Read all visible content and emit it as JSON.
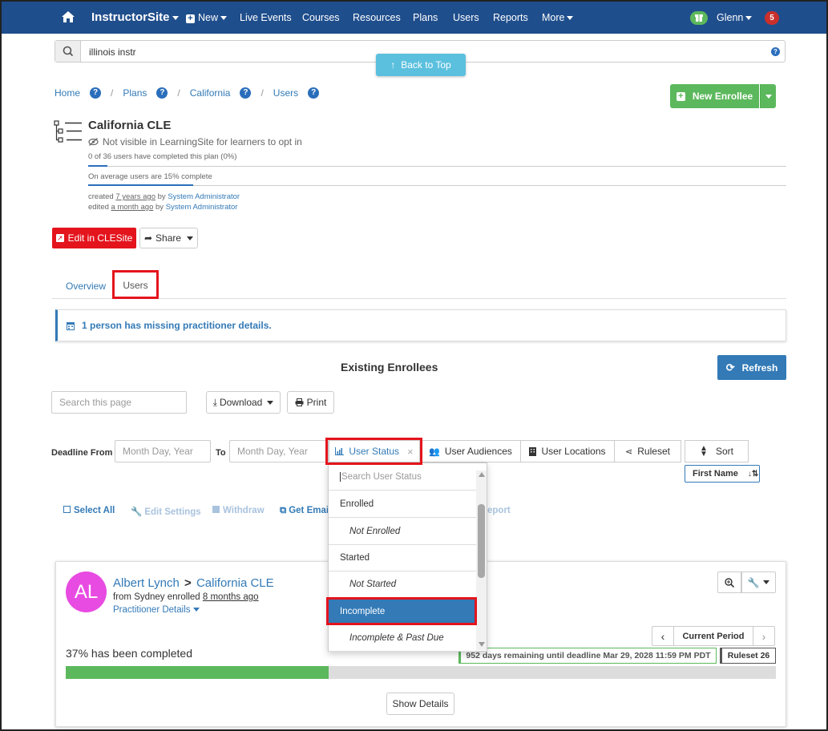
{
  "nav": {
    "brand": "InstructorSite",
    "new": "New",
    "items": [
      "Live Events",
      "Courses",
      "Resources",
      "Plans",
      "Users",
      "Reports",
      "More"
    ],
    "user": "Glenn",
    "notifications": "5"
  },
  "search": {
    "value": "illinois instr"
  },
  "back_to_top": "Back to Top",
  "breadcrumb": {
    "home": "Home",
    "plans": "Plans",
    "state": "California",
    "users": "Users",
    "sep": "/"
  },
  "new_enrollee": "New Enrollee",
  "plan": {
    "title": "California CLE",
    "visibility": "Not visible in LearningSite for learners to opt in",
    "completed": "0 of 36 users have completed this plan (0%)",
    "average": "On average users are 15% complete",
    "average_progress": 0.15,
    "created_prefix": "created",
    "created_ago": "7 years ago",
    "by": "by",
    "created_by": "System Administrator",
    "edited_prefix": "edited",
    "edited_ago": "a month ago",
    "edited_by": "System Administrator"
  },
  "edit_button": "Edit in CLESite",
  "share_button": "Share",
  "tabs": {
    "overview": "Overview",
    "users": "Users"
  },
  "alert": "1 person has missing practitioner details.",
  "section_title": "Existing Enrollees",
  "refresh": "Refresh",
  "search_page_placeholder": "Search this page",
  "download": "Download",
  "print": "Print",
  "filters": {
    "deadline_from": "Deadline From",
    "to": "To",
    "date_placeholder": "Month Day, Year",
    "user_status": "User Status",
    "user_audiences": "User Audiences",
    "user_locations": "User Locations",
    "ruleset": "Ruleset",
    "sort": "Sort",
    "first_name": "First Name"
  },
  "dropdown": {
    "search_placeholder": "Search User Status",
    "options": [
      "Enrolled",
      "Not Enrolled",
      "Started",
      "Not Started",
      "Incomplete",
      "Incomplete & Past Due"
    ],
    "selected": "Incomplete"
  },
  "actions": {
    "select_all": "Select All",
    "edit_settings": "Edit Settings",
    "withdraw": "Withdraw",
    "get_email": "Get Emai",
    "report_tail": "eport"
  },
  "enrollee": {
    "initials": "AL",
    "name": "Albert Lynch",
    "plan": "California CLE",
    "from": "from Sydney enrolled",
    "enrolled_ago": "8 months ago",
    "practitioner": "Practitioner Details",
    "period": "Current Period",
    "completed_text": "37% has been completed",
    "progress": 0.37,
    "deadline": "952 days remaining until deadline Mar 29, 2028 11:59 PM PDT",
    "ruleset": "Ruleset 26",
    "show_details": "Show Details"
  },
  "colors": {
    "nav": "#1f4e8c",
    "green": "#5cb85c",
    "primary": "#337ab7",
    "red": "#e4141d",
    "avatar": "#e84be2"
  }
}
